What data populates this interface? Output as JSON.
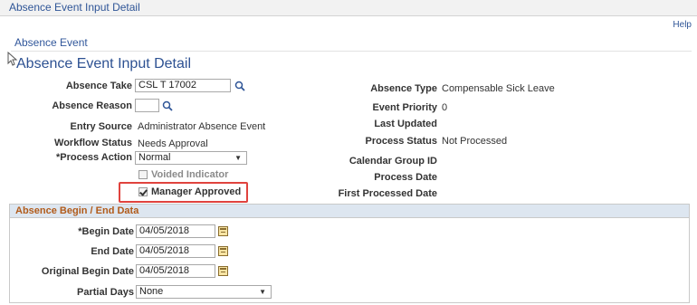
{
  "breadcrumb": "Absence Event Input Detail",
  "help_link": "Help",
  "section_tab": "Absence Event",
  "page_title": "Absence Event Input Detail",
  "left_fields": {
    "absence_take": {
      "label": "Absence Take",
      "value": "CSL T 17002"
    },
    "absence_reason": {
      "label": "Absence Reason",
      "value": ""
    },
    "entry_source": {
      "label": "Entry Source",
      "value": "Administrator Absence Event"
    },
    "workflow_status": {
      "label": "Workflow Status",
      "value": "Needs Approval"
    },
    "process_action": {
      "label": "*Process Action",
      "value": "Normal"
    },
    "voided_indicator": {
      "label": "Voided Indicator",
      "checked": false
    },
    "manager_approved": {
      "label": "Manager Approved",
      "checked": true
    }
  },
  "right_fields": {
    "absence_type": {
      "label": "Absence Type",
      "value": "Compensable Sick Leave"
    },
    "event_priority": {
      "label": "Event Priority",
      "value": "0"
    },
    "last_updated": {
      "label": "Last Updated",
      "value": ""
    },
    "process_status": {
      "label": "Process Status",
      "value": "Not Processed"
    },
    "calendar_group_id": {
      "label": "Calendar Group ID",
      "value": ""
    },
    "process_date": {
      "label": "Process Date",
      "value": ""
    },
    "first_processed_date": {
      "label": "First Processed Date",
      "value": ""
    }
  },
  "dates_group": {
    "header": "Absence Begin / End Data",
    "begin_date": {
      "label": "*Begin Date",
      "value": "04/05/2018"
    },
    "end_date": {
      "label": "End Date",
      "value": "04/05/2018"
    },
    "original_begin_date": {
      "label": "Original Begin Date",
      "value": "04/05/2018"
    },
    "partial_days": {
      "label": "Partial Days",
      "value": "None"
    }
  },
  "colors": {
    "link": "#2f5597",
    "title": "#2d5192",
    "group_header_text": "#b15b1a",
    "highlight": "#e0433e"
  }
}
